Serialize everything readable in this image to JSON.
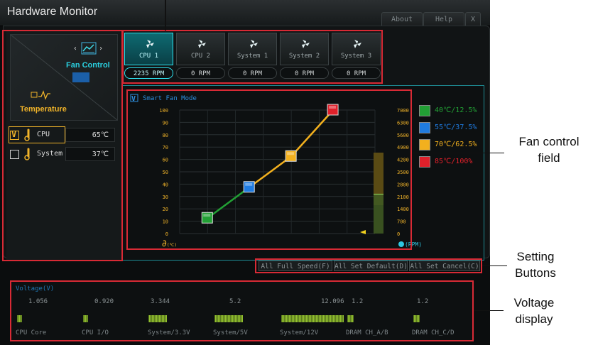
{
  "window": {
    "title": "Hardware Monitor",
    "buttons": [
      "About",
      "Help",
      "X"
    ]
  },
  "mode_panel": {
    "fan_control_label": "Fan Control",
    "temperature_label": "Temperature"
  },
  "temperature_sources": [
    {
      "name": "CPU",
      "value": "65℃",
      "checked": true
    },
    {
      "name": "System",
      "value": "37℃",
      "checked": false
    }
  ],
  "fans": [
    {
      "label": "CPU 1",
      "rpm": "2235 RPM",
      "active": true
    },
    {
      "label": "CPU 2",
      "rpm": "0 RPM",
      "active": false
    },
    {
      "label": "System 1",
      "rpm": "0 RPM",
      "active": false
    },
    {
      "label": "System 2",
      "rpm": "0 RPM",
      "active": false
    },
    {
      "label": "System 3",
      "rpm": "0 RPM",
      "active": false
    }
  ],
  "graph": {
    "mode_label": "Smart Fan Mode",
    "mode_checked": true,
    "y_left_ticks": [
      "100",
      "90",
      "80",
      "70",
      "60",
      "50",
      "40",
      "30",
      "20",
      "10",
      "0"
    ],
    "y_right_ticks": [
      "7000",
      "6300",
      "5600",
      "4900",
      "4200",
      "3500",
      "2800",
      "2100",
      "1400",
      "700",
      "0"
    ],
    "x_unit": "(℃)",
    "rpm_unit": "(RPM)",
    "current_rpm_marker": 2235
  },
  "chart_data": {
    "type": "line",
    "xlabel": "(℃)",
    "ylabel": "",
    "ylim": [
      0,
      100
    ],
    "series": [
      {
        "points": [
          {
            "temp": 40,
            "pct": 12.5
          },
          {
            "temp": 55,
            "pct": 37.5
          },
          {
            "temp": 70,
            "pct": 62.5
          },
          {
            "temp": 85,
            "pct": 100
          }
        ]
      }
    ]
  },
  "legend": [
    {
      "label": "40℃/12.5%",
      "color": "#22a035"
    },
    {
      "label": "55℃/37.5%",
      "color": "#1f7be0"
    },
    {
      "label": "70℃/62.5%",
      "color": "#f2b01e"
    },
    {
      "label": "85℃/100%",
      "color": "#e0202a"
    }
  ],
  "setting_buttons": [
    "All Full Speed(F)",
    "All Set Default(D)",
    "All Set Cancel(C)"
  ],
  "voltage": {
    "title": "Voltage(V)",
    "items": [
      {
        "label": "CPU Core",
        "value": "1.056"
      },
      {
        "label": "CPU I/O",
        "value": "0.920"
      },
      {
        "label": "System/3.3V",
        "value": "3.344"
      },
      {
        "label": "System/5V",
        "value": "5.2"
      },
      {
        "label": "System/12V",
        "value": "12.096"
      },
      {
        "label": "DRAM CH_A/B",
        "value": "1.2"
      },
      {
        "label": "DRAM CH_C/D",
        "value": "1.2"
      }
    ]
  },
  "callouts": {
    "fan_control": "Fan control field",
    "setting_buttons": "Setting Buttons",
    "voltage": "Voltage display"
  }
}
